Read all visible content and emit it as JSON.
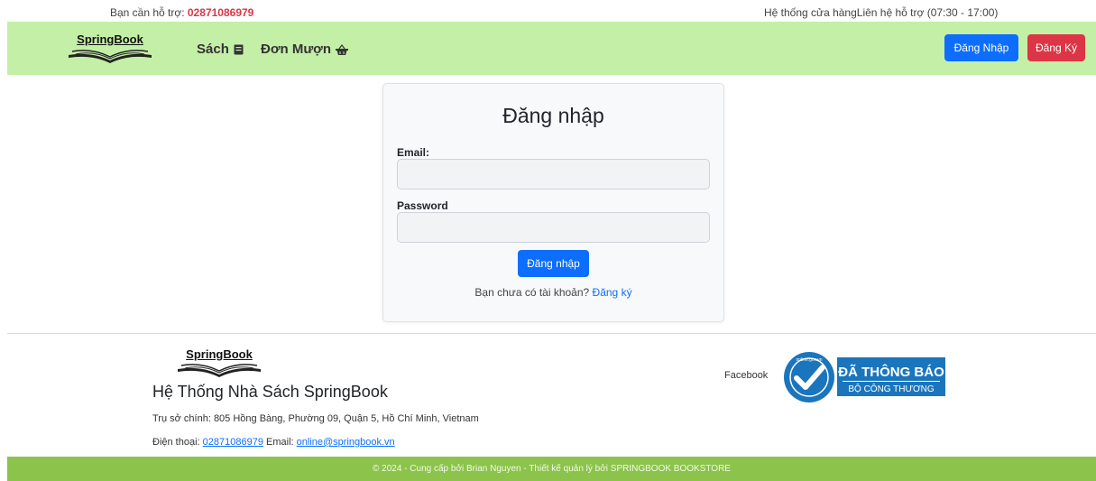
{
  "topbar": {
    "support_label": "Bạn cần hỗ trợ: ",
    "support_phone": "02871086979",
    "right_text": "Hệ thống cửa hàngLiên hệ hỗ trợ (07:30 - 17:00)"
  },
  "navbar": {
    "brand": "SpringBook",
    "books_label": "Sách",
    "books_icon": "book-icon",
    "orders_label": "Đơn Mượn",
    "orders_icon": "basket-icon",
    "login_label": "Đăng Nhập",
    "register_label": "Đăng Ký"
  },
  "login": {
    "title": "Đăng nhập",
    "email_label": "Email:",
    "email_value": "",
    "password_label": "Password",
    "password_value": "",
    "submit_label": "Đăng nhập",
    "no_account_text": "Bạn chưa có tài khoản? ",
    "register_link": "Đăng ký"
  },
  "footer": {
    "brand": "SpringBook",
    "store_name": "Hệ Thống Nhà Sách SpringBook",
    "address": "Trụ sở chính: 805 Hồng Bàng, Phường 09, Quận 5, Hồ Chí Minh, Vietnam",
    "phone_label": "Điện thoại: ",
    "phone": "02871086979",
    "email_label": " Email: ",
    "email": "online@springbook.vn",
    "facebook": "Facebook",
    "cert_seal": "online.gov.vn",
    "cert_title": "ĐÃ THÔNG BÁO",
    "cert_subtitle": "BỘ CÔNG THƯƠNG",
    "copyright": "© 2024 - Cung cấp bởi Brian Nguyen - Thiết kế quản lý bởi SPRINGBOOK BOOKSTORE"
  },
  "colors": {
    "navbar_bg": "#c4efa6",
    "primary": "#0d6efd",
    "danger": "#dc3545",
    "footer_bar": "#8cc34b",
    "cert_blue": "#1b75bc"
  }
}
